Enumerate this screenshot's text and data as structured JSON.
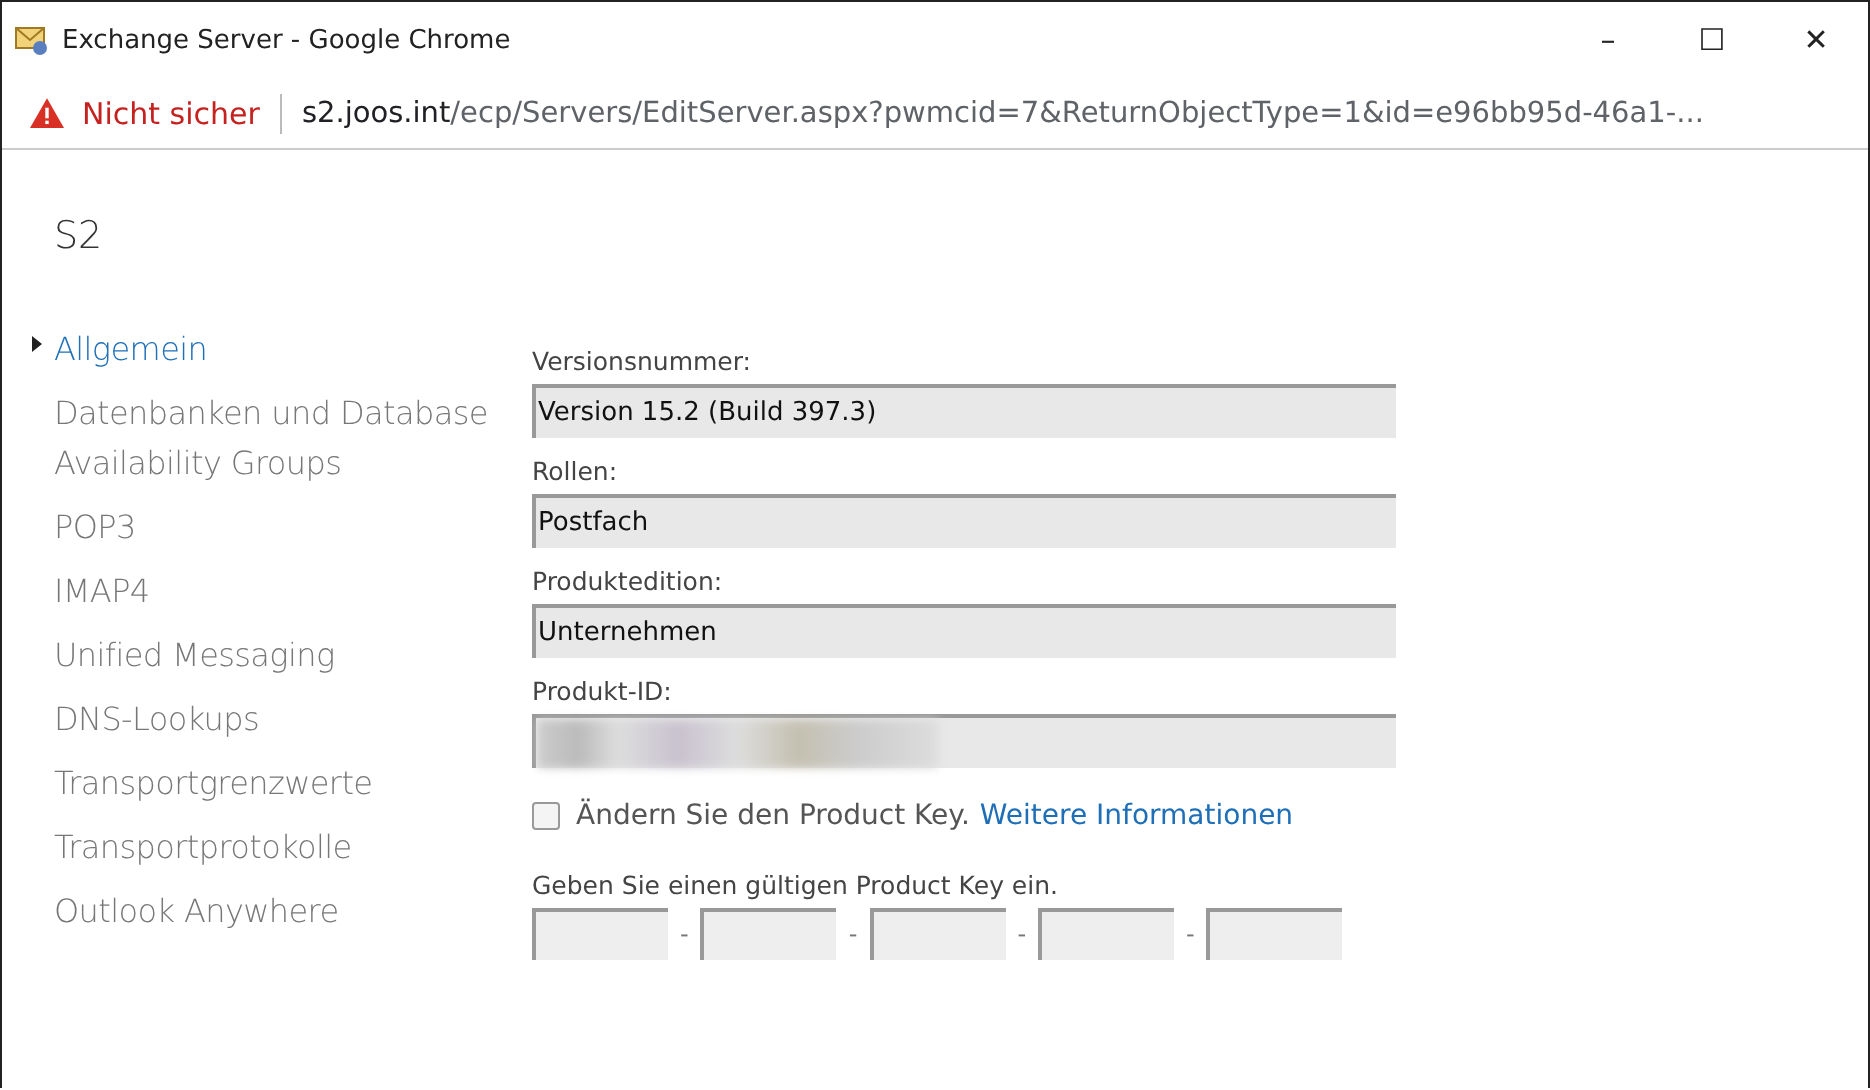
{
  "window": {
    "title": "Exchange Server - Google Chrome",
    "controls": [
      "–",
      "☐",
      "✕"
    ]
  },
  "address_bar": {
    "security": "Nicht sicher",
    "host": "s2.joos.int",
    "path": "/ecp/Servers/EditServer.aspx?pwmcid=7&ReturnObjectType=1&id=e96bb95d-46a1-..."
  },
  "page_title": "S2",
  "sidebar": {
    "items": [
      {
        "label": "Allgemein",
        "selected": true
      },
      {
        "label": "Datenbanken und Database Availability Groups",
        "selected": false
      },
      {
        "label": "POP3",
        "selected": false
      },
      {
        "label": "IMAP4",
        "selected": false
      },
      {
        "label": "Unified Messaging",
        "selected": false
      },
      {
        "label": "DNS-Lookups",
        "selected": false
      },
      {
        "label": "Transportgrenzwerte",
        "selected": false
      },
      {
        "label": "Transportprotokolle",
        "selected": false
      },
      {
        "label": "Outlook Anywhere",
        "selected": false
      }
    ]
  },
  "fields": [
    {
      "label": "Versionsnummer:",
      "value": "Version 15.2 (Build 397.3)",
      "blurred": false
    },
    {
      "label": "Rollen:",
      "value": "Postfach",
      "blurred": false
    },
    {
      "label": "Produktedition:",
      "value": "Unternehmen",
      "blurred": false
    },
    {
      "label": "Produkt-ID:",
      "blurred": true
    }
  ],
  "change_key": {
    "label": "Ändern Sie den Product Key.",
    "link": "Weitere Informationen",
    "checked": false
  },
  "product_key": {
    "label": "Geben Sie einen gültigen Product Key ein.",
    "separators": [
      "-",
      "-",
      "-",
      "-"
    ]
  }
}
